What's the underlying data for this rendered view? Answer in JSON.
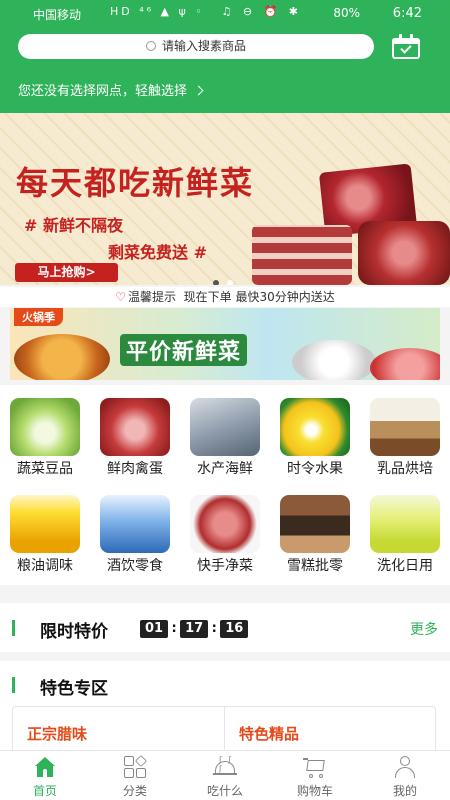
{
  "status_bar": {
    "carrier": "中国移动",
    "signal_icons": "HD ⁴⁶ ▲ ψ ◦",
    "right_icons": "♫ ⊖ ⏰ ✱",
    "battery": "80%",
    "time": "6:42"
  },
  "header": {
    "search_placeholder": "请输入搜素商品",
    "branch_prompt": "您还没有选择网点，轻触选择"
  },
  "banner": {
    "headline": "每天都吃新鲜菜",
    "line1": "# 新鲜不隔夜",
    "line2": "剩菜免费送 #",
    "cta": "马上抢购>",
    "active_slide": 1,
    "slide_count": 2
  },
  "notice": {
    "label": "温馨提示",
    "text": "现在下单 最快30分钟内送达"
  },
  "promo": {
    "tag": "火锅季",
    "title": "平价新鲜菜"
  },
  "categories": [
    {
      "label": "蔬菜豆品",
      "icon": "cabbage-icon"
    },
    {
      "label": "鲜肉禽蛋",
      "icon": "meat-icon"
    },
    {
      "label": "水产海鲜",
      "icon": "fish-icon"
    },
    {
      "label": "时令水果",
      "icon": "watermelon-icon"
    },
    {
      "label": "乳品烘培",
      "icon": "dairy-bakery-icon"
    },
    {
      "label": "粮油调味",
      "icon": "cooking-oil-icon"
    },
    {
      "label": "酒饮零食",
      "icon": "bottled-water-icon"
    },
    {
      "label": "快手净菜",
      "icon": "sliced-meat-icon"
    },
    {
      "label": "雪糕批零",
      "icon": "ice-cream-icon"
    },
    {
      "label": "洗化日用",
      "icon": "detergent-icon"
    }
  ],
  "flash_sale": {
    "title": "限时特价",
    "countdown": {
      "h": "01",
      "m": "17",
      "s": "16"
    },
    "more": "更多"
  },
  "special_zone": {
    "title": "特色专区",
    "cards": [
      "正宗腊味",
      "特色精品"
    ]
  },
  "tabbar": {
    "items": [
      {
        "label": "首页",
        "icon": "home-icon",
        "active": true
      },
      {
        "label": "分类",
        "icon": "category-icon",
        "active": false
      },
      {
        "label": "吃什么",
        "icon": "dish-cover-icon",
        "active": false
      },
      {
        "label": "购物车",
        "icon": "cart-icon",
        "active": false
      },
      {
        "label": "我的",
        "icon": "user-icon",
        "active": false
      }
    ]
  },
  "colors": {
    "brand_green": "#2fb35a",
    "accent_red": "#c5221f",
    "accent_orange": "#e64a19"
  }
}
